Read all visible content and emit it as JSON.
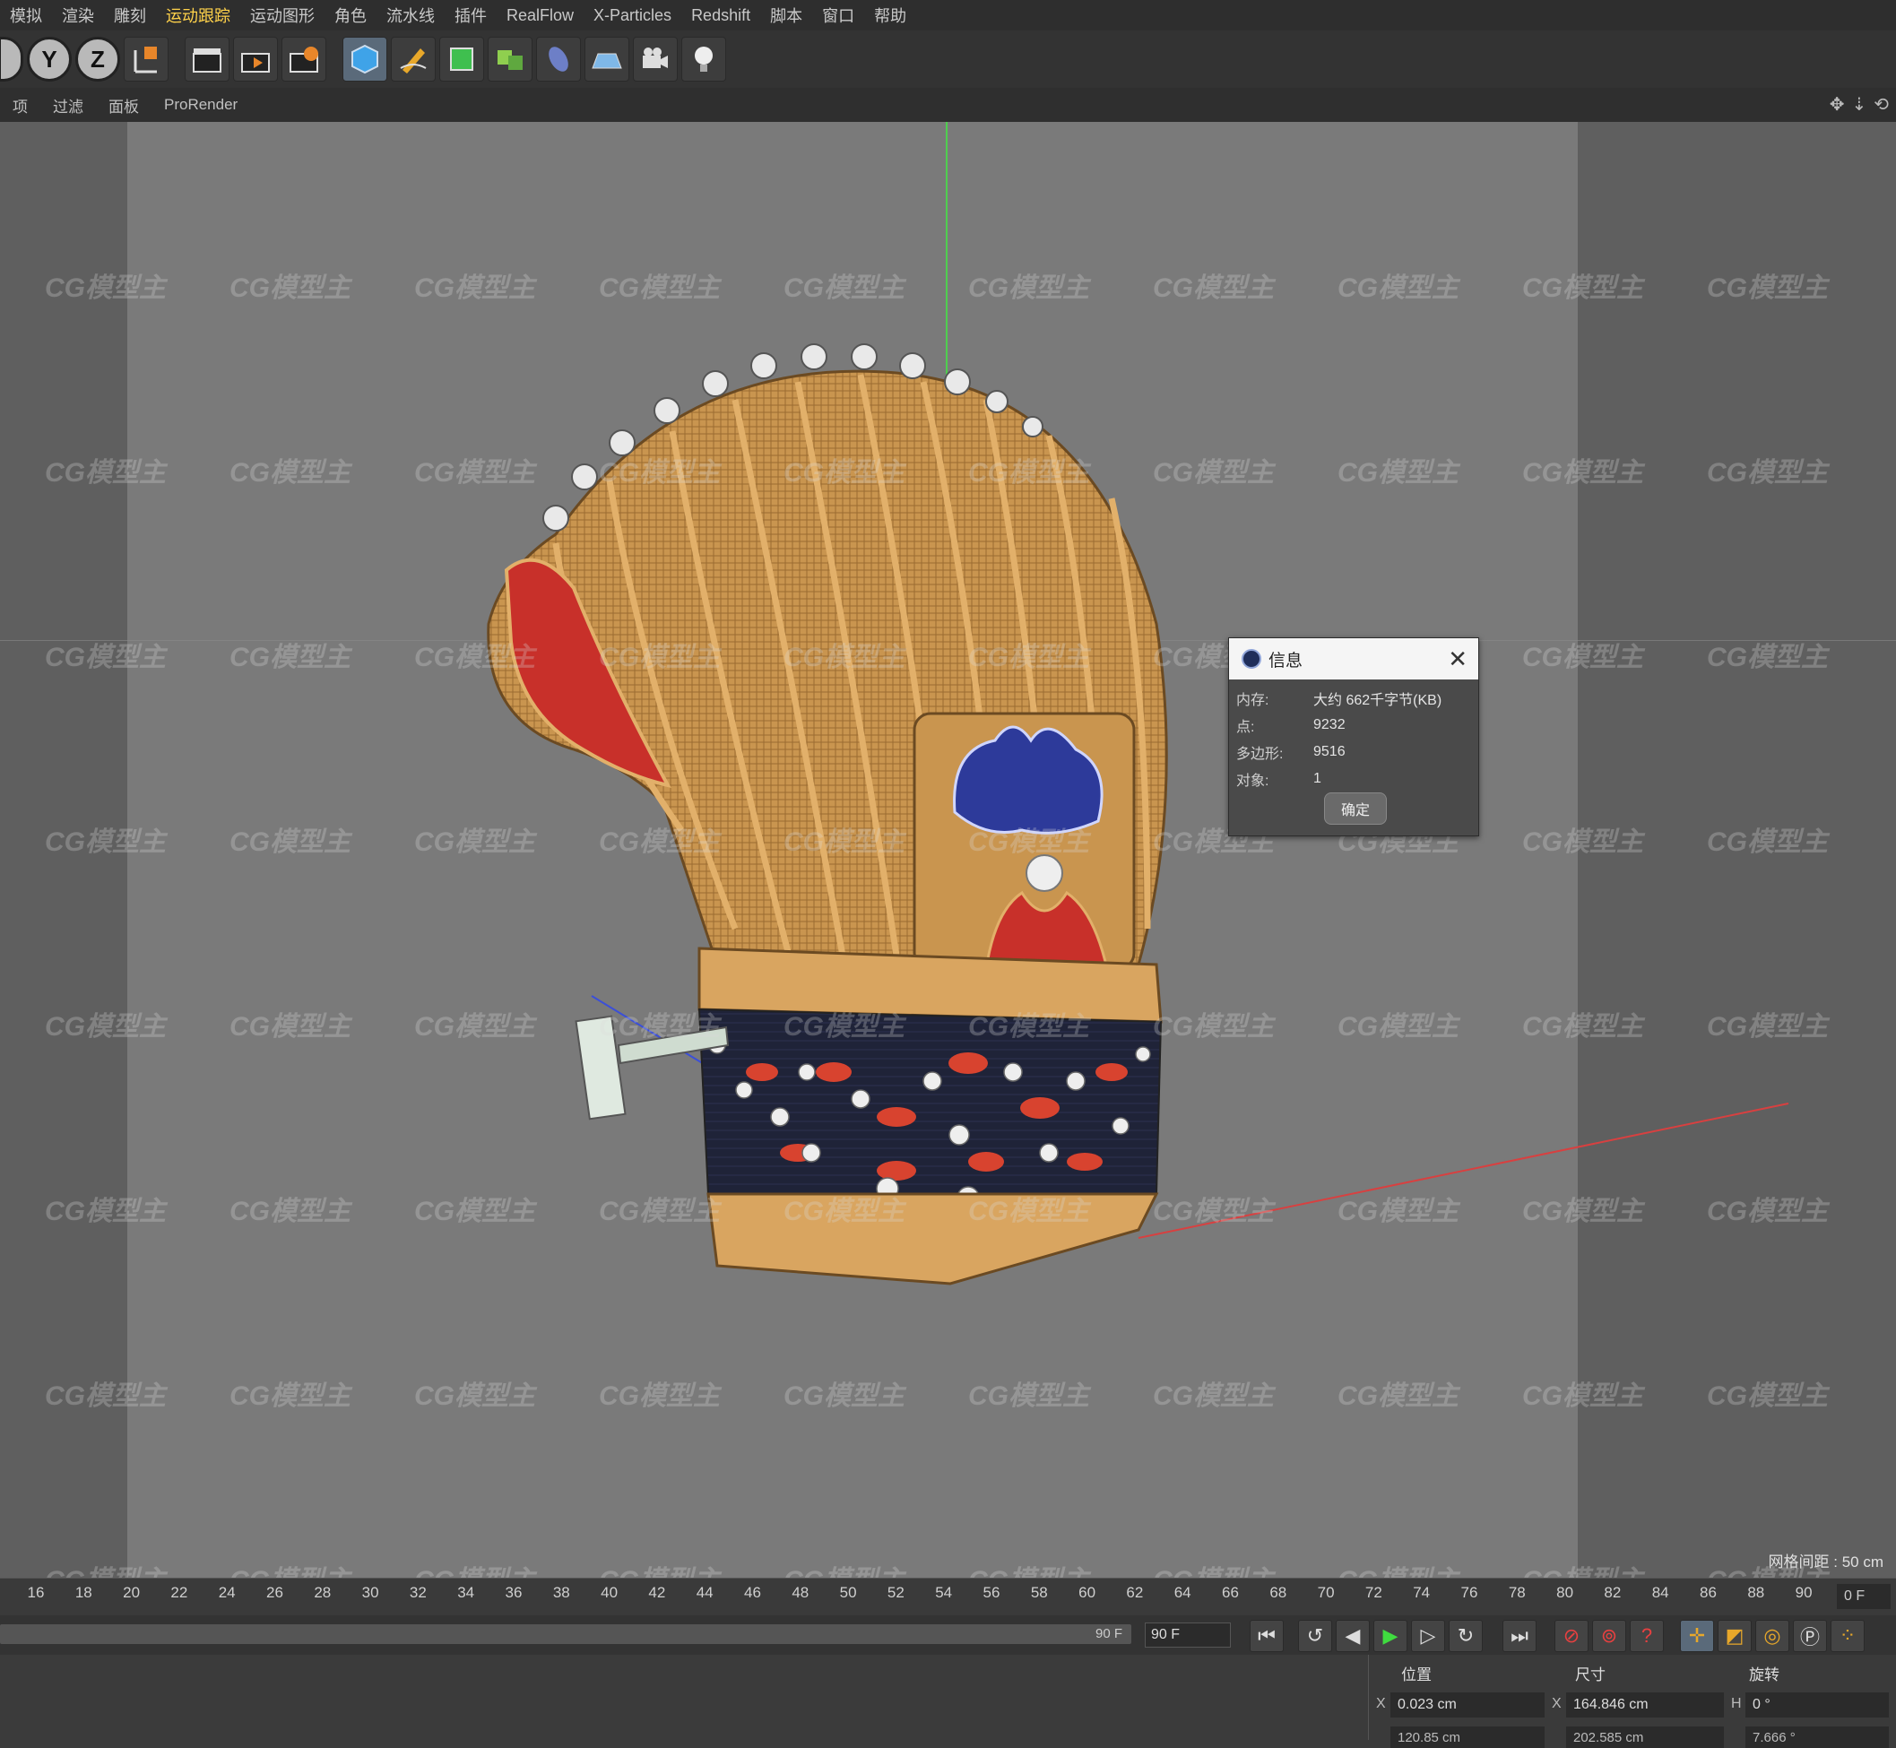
{
  "menu": {
    "items": [
      "模拟",
      "渲染",
      "雕刻",
      "运动跟踪",
      "运动图形",
      "角色",
      "流水线",
      "插件",
      "RealFlow",
      "X-Particles",
      "Redshift",
      "脚本",
      "窗口",
      "帮助"
    ],
    "active": "运动跟踪"
  },
  "toolbar": {
    "axis_y": "Y",
    "axis_z": "Z"
  },
  "viewmenu": {
    "items": [
      "项",
      "过滤",
      "面板",
      "ProRender"
    ]
  },
  "viewport": {
    "grid_spacing": "网格间距 : 50 cm",
    "watermark": "CG模型主"
  },
  "dialog": {
    "title": "信息",
    "rows": [
      {
        "label": "内存:",
        "value": "大约 662千字节(KB)"
      },
      {
        "label": "点:",
        "value": "9232"
      },
      {
        "label": "多边形:",
        "value": "9516"
      },
      {
        "label": "对象:",
        "value": "1"
      }
    ],
    "ok": "确定"
  },
  "timeline": {
    "ticks": [
      "16",
      "18",
      "20",
      "22",
      "24",
      "26",
      "28",
      "30",
      "32",
      "34",
      "36",
      "38",
      "40",
      "42",
      "44",
      "46",
      "48",
      "50",
      "52",
      "54",
      "56",
      "58",
      "60",
      "62",
      "64",
      "66",
      "68",
      "70",
      "72",
      "74",
      "76",
      "78",
      "80",
      "82",
      "84",
      "86",
      "88",
      "90"
    ],
    "current_frame": "0 F"
  },
  "transport": {
    "scrub_end": "90 F",
    "end_frame": "90 F"
  },
  "coords": {
    "position_header": "位置",
    "size_header": "尺寸",
    "rotation_header": "旋转",
    "pos_x_label": "X",
    "pos_x": "0.023 cm",
    "size_x_label": "X",
    "size_x": "164.846 cm",
    "rot_h_label": "H",
    "rot_h": "0 °",
    "pos_y": "120.85 cm",
    "size_y": "202.585 cm",
    "rot_p": "7.666 °"
  },
  "colors": {
    "active_menu": "#ffd24a",
    "viewport_bg": "#7a7a7a",
    "helmet_gold": "#c9954f",
    "cloud_red": "#d8432f",
    "band_navy": "#1f2338"
  }
}
